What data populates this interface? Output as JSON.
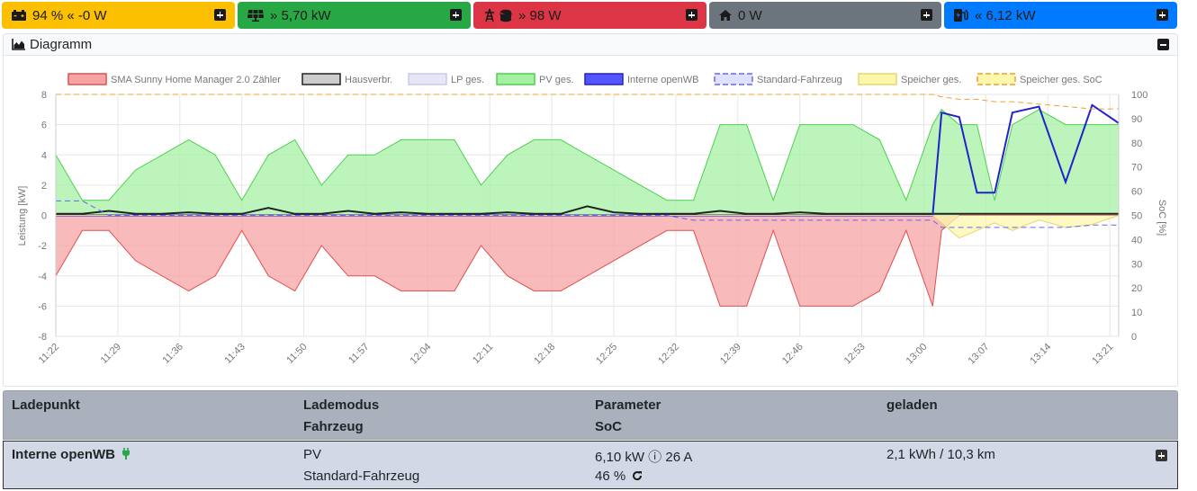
{
  "topbar": {
    "battery": {
      "text": "94 % « -0 W",
      "color": "#fcc000",
      "icon": "car-battery-icon"
    },
    "pv": {
      "text": "» 5,70 kW",
      "color": "#28a745",
      "icon": "solar-panel-icon"
    },
    "grid": {
      "text": "» 98 W",
      "color": "#dc3545",
      "icon": "power-tower-coins-icon"
    },
    "house": {
      "text": "0 W",
      "color": "#6c757d",
      "icon": "home-icon"
    },
    "charge": {
      "text": "« 6,12 kW",
      "color": "#007bff",
      "icon": "charging-station-icon"
    }
  },
  "diagram": {
    "title": "Diagramm",
    "legend": [
      {
        "label": "SMA Sunny Home Manager 2.0 Zähler",
        "color": "#f5a3a3",
        "border": "#e05050",
        "dashed": false
      },
      {
        "label": "Hausverbr.",
        "color": "#cccccc",
        "border": "#222222",
        "dashed": false
      },
      {
        "label": "LP ges.",
        "color": "#e6e6f7",
        "border": "#c8c8ee",
        "dashed": false
      },
      {
        "label": "PV ges.",
        "color": "#a6f0a6",
        "border": "#4cd24c",
        "dashed": false
      },
      {
        "label": "Interne openWB",
        "color": "#5555ff",
        "border": "#2222cc",
        "dashed": false
      },
      {
        "label": "Standard-Fahrzeug",
        "color": "#e0e0ff",
        "border": "#6666ee",
        "dashed": true
      },
      {
        "label": "Speicher ges.",
        "color": "#fbf7ad",
        "border": "#e8d66a",
        "dashed": false
      },
      {
        "label": "Speicher ges. SoC",
        "color": "#fbf7ad",
        "border": "#f0a030",
        "dashed": true
      }
    ],
    "y_left_label": "Leistung [kW]",
    "y_right_label": "SoC [%]",
    "y_left_ticks": [
      "8",
      "6",
      "4",
      "2",
      "0",
      "-2",
      "-4",
      "-6",
      "-8"
    ],
    "y_right_ticks": [
      "100",
      "90",
      "80",
      "70",
      "60",
      "50",
      "40",
      "30",
      "20",
      "10",
      "0"
    ],
    "x_ticks": [
      "11:22",
      "11:29",
      "11:36",
      "11:43",
      "11:50",
      "11:57",
      "12:04",
      "12:11",
      "12:18",
      "12:25",
      "12:32",
      "12:39",
      "12:46",
      "12:53",
      "13:00",
      "13:07",
      "13:14",
      "13:21"
    ]
  },
  "chart_data": {
    "type": "area",
    "title": "",
    "xlabel": "",
    "ylabel": "Leistung [kW]",
    "y2label": "SoC [%]",
    "ylim": [
      -8,
      8
    ],
    "y2lim": [
      0,
      100
    ],
    "grid": true,
    "legend_position": "top",
    "x_minutes_from_start": [
      0,
      3,
      6,
      9,
      12,
      15,
      18,
      21,
      24,
      27,
      30,
      33,
      36,
      39,
      42,
      45,
      48,
      51,
      54,
      57,
      60,
      63,
      66,
      69,
      72,
      75,
      78,
      81,
      84,
      87,
      90,
      93,
      96,
      99,
      100,
      102,
      104,
      106,
      108,
      111,
      114,
      117,
      120
    ],
    "x_start": "11:22",
    "series": [
      {
        "name": "PV ges.",
        "values": [
          4,
          1,
          1,
          3,
          4,
          5,
          4,
          1,
          4,
          5,
          2,
          4,
          4,
          5,
          5,
          5,
          2,
          4,
          5,
          5,
          4,
          3,
          2,
          1,
          1,
          6,
          6,
          1,
          6,
          6,
          6,
          5,
          1,
          6,
          7,
          6,
          6,
          1,
          6,
          7,
          6,
          6,
          6
        ]
      },
      {
        "name": "SMA Sunny Home Manager 2.0 Zähler",
        "values": [
          -4,
          -1,
          -1,
          -3,
          -4,
          -5,
          -4,
          -1,
          -4,
          -5,
          -2,
          -4,
          -4,
          -5,
          -5,
          -5,
          -2,
          -4,
          -5,
          -5,
          -4,
          -3,
          -2,
          -1,
          -1,
          -6,
          -6,
          -1,
          -6,
          -6,
          -6,
          -5,
          -1,
          -6,
          -1,
          0,
          0,
          0,
          0,
          0,
          0,
          0,
          0
        ]
      },
      {
        "name": "Hausverbr.",
        "values": [
          0.1,
          0.1,
          0.3,
          0.1,
          0.1,
          0.2,
          0.1,
          0.1,
          0.5,
          0.1,
          0.1,
          0.3,
          0.1,
          0.2,
          0.1,
          0.1,
          0.1,
          0.2,
          0.1,
          0.1,
          0.6,
          0.2,
          0.1,
          0.1,
          0.1,
          0.3,
          0.1,
          0.1,
          0.2,
          0.1,
          0.1,
          0.1,
          0.1,
          0.1,
          0.1,
          0.1,
          0.1,
          0.1,
          0.1,
          0.1,
          0.1,
          0.1,
          0.1
        ]
      },
      {
        "name": "Interne openWB",
        "values": [
          0,
          0,
          0,
          0,
          0,
          0,
          0,
          0,
          0,
          0,
          0,
          0,
          0,
          0,
          0,
          0,
          0,
          0,
          0,
          0,
          0,
          0,
          0,
          0,
          0,
          0,
          0,
          0,
          0,
          0,
          0,
          0,
          0,
          0,
          6.8,
          6.5,
          1.5,
          1.5,
          6.8,
          7.2,
          2.2,
          7.3,
          6.1
        ]
      },
      {
        "name": "Speicher ges.",
        "values": [
          0,
          0,
          0,
          0,
          0,
          0,
          0,
          0,
          0,
          0,
          0,
          0,
          0,
          0,
          0,
          0,
          0,
          0,
          0,
          0,
          0,
          0,
          0,
          0,
          0,
          0,
          0,
          0,
          0,
          0,
          0,
          0,
          0,
          0,
          -0.5,
          -1.5,
          -1,
          -0.5,
          -1,
          -0.3,
          -0.8,
          -0.6,
          0
        ]
      },
      {
        "name": "Standard-Fahrzeug",
        "axis": "right",
        "values": [
          56,
          56,
          50,
          50,
          50,
          50,
          50,
          50,
          50,
          50,
          50,
          50,
          50,
          50,
          50,
          50,
          50,
          50,
          50,
          50,
          50,
          50,
          50,
          50,
          48,
          48,
          48,
          48,
          48,
          48,
          48,
          48,
          48,
          48,
          45,
          45,
          45,
          45,
          45,
          45,
          45,
          46,
          46
        ]
      },
      {
        "name": "Speicher ges. SoC",
        "axis": "right",
        "values": [
          100,
          100,
          100,
          100,
          100,
          100,
          100,
          100,
          100,
          100,
          100,
          100,
          100,
          100,
          100,
          100,
          100,
          100,
          100,
          100,
          100,
          100,
          100,
          100,
          100,
          100,
          100,
          100,
          100,
          100,
          100,
          100,
          100,
          100,
          99,
          98,
          98,
          97,
          97,
          96,
          95,
          94,
          94
        ]
      }
    ]
  },
  "table": {
    "headers": {
      "ladepunkt": "Ladepunkt",
      "lademodus": "Lademodus",
      "fahrzeug": "Fahrzeug",
      "parameter": "Parameter",
      "soc": "SoC",
      "geladen": "geladen"
    },
    "row": {
      "name": "Interne openWB",
      "mode": "PV",
      "vehicle": "Standard-Fahrzeug",
      "parameter": "6,10 kW ⓘ 26 A",
      "soc": "46 %",
      "geladen": "2,1 kWh / 10,3 km"
    }
  }
}
